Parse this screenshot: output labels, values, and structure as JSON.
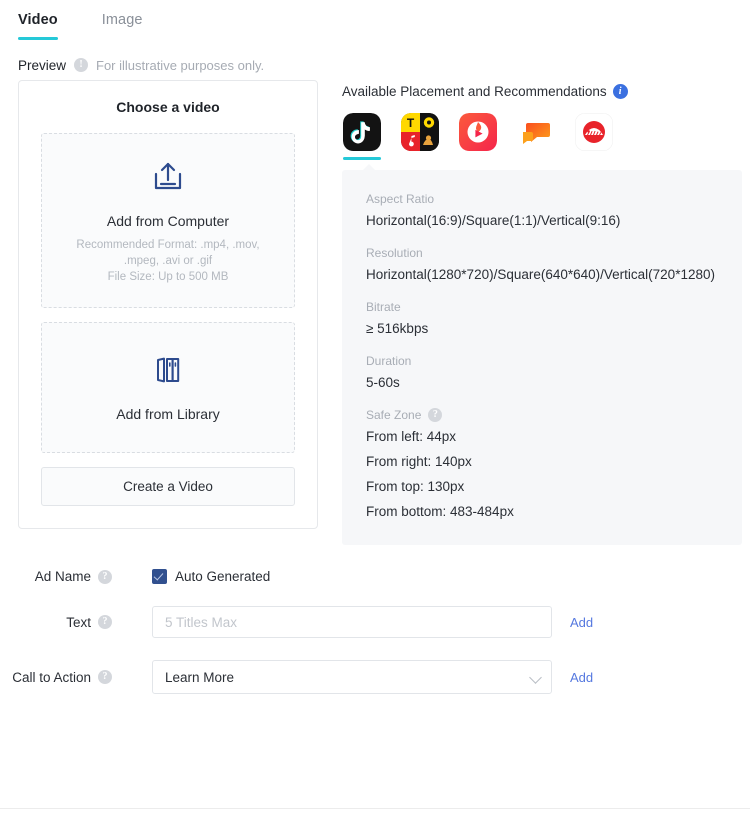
{
  "tabs": [
    {
      "label": "Video",
      "active": true
    },
    {
      "label": "Image",
      "active": false
    }
  ],
  "preview": {
    "label": "Preview",
    "note": "For illustrative purposes only.",
    "help_icon": "help-icon"
  },
  "video_card": {
    "title": "Choose a video",
    "upload": {
      "icon": "upload-icon",
      "title": "Add from Computer",
      "sub_line1": "Recommended Format: .mp4, .mov,",
      "sub_line2": ".mpeg, .avi or .gif",
      "sub_line3": "File Size: Up to 500 MB"
    },
    "library": {
      "icon": "library-icon",
      "title": "Add from Library"
    },
    "create_button": "Create a Video"
  },
  "placements": {
    "heading": "Available Placement and Recommendations",
    "info_icon": "info-icon",
    "items": [
      {
        "name": "tiktok",
        "selected": true
      },
      {
        "name": "topbuzz",
        "selected": false
      },
      {
        "name": "helo",
        "selected": false
      },
      {
        "name": "babe",
        "selected": false
      },
      {
        "name": "pangle",
        "selected": false
      }
    ]
  },
  "specs": [
    {
      "label": "Aspect Ratio",
      "value": "Horizontal(16:9)/Square(1:1)/Vertical(9:16)"
    },
    {
      "label": "Resolution",
      "value": "Horizontal(1280*720)/Square(640*640)/Vertical(720*1280)"
    },
    {
      "label": "Bitrate",
      "value": "≥ 516kbps"
    },
    {
      "label": "Duration",
      "value": "5-60s"
    }
  ],
  "safe_zone": {
    "label": "Safe Zone",
    "help_icon": "help-icon",
    "lines": [
      "From left: 44px",
      "From right: 140px",
      "From top: 130px",
      "From bottom: 483-484px"
    ]
  },
  "form": {
    "ad_name": {
      "label": "Ad Name",
      "help_icon": "help-icon",
      "checkbox_label": "Auto Generated",
      "checked": true
    },
    "text": {
      "label": "Text",
      "help_icon": "help-icon",
      "value": "",
      "placeholder": "5 Titles Max",
      "add_label": "Add"
    },
    "call_to_action": {
      "label": "Call to Action",
      "help_icon": "help-icon",
      "selected": "Learn More",
      "add_label": "Add",
      "chevron_icon": "chevron-down-icon"
    }
  },
  "colors": {
    "accent_teal": "#25c9d8",
    "link_blue": "#5578df",
    "checkbox_blue": "#31508f",
    "info_blue": "#3b70e0",
    "panel_bg": "#f6f7f9"
  }
}
